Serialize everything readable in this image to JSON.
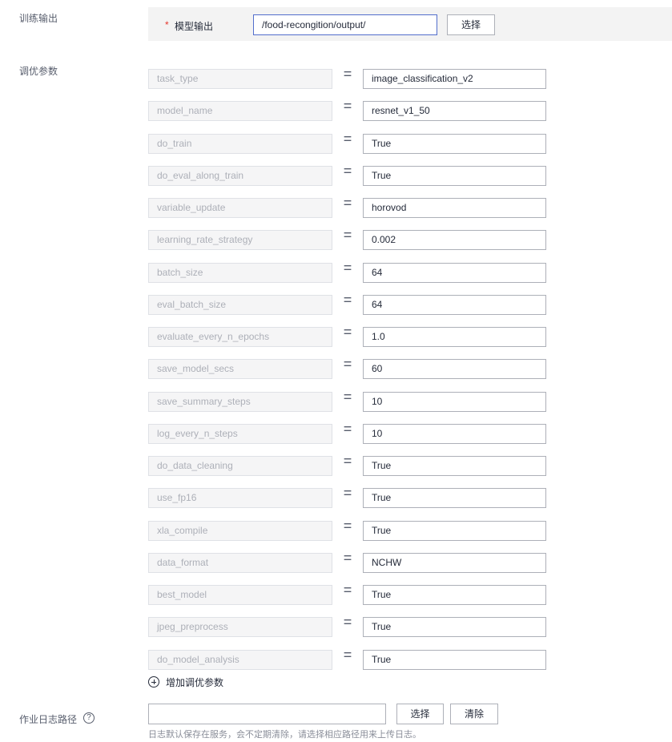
{
  "training_output": {
    "section_label": "训练输出",
    "required_mark": "*",
    "field_label": "模型输出",
    "path_value": "/food-recongition/output/",
    "select_button": "选择"
  },
  "tuning_params": {
    "section_label": "调优参数",
    "equals_sign": "=",
    "rows": [
      {
        "key": "task_type",
        "value": "image_classification_v2"
      },
      {
        "key": "model_name",
        "value": "resnet_v1_50"
      },
      {
        "key": "do_train",
        "value": "True"
      },
      {
        "key": "do_eval_along_train",
        "value": "True"
      },
      {
        "key": "variable_update",
        "value": "horovod"
      },
      {
        "key": "learning_rate_strategy",
        "value": "0.002"
      },
      {
        "key": "batch_size",
        "value": "64"
      },
      {
        "key": "eval_batch_size",
        "value": "64"
      },
      {
        "key": "evaluate_every_n_epochs",
        "value": "1.0"
      },
      {
        "key": "save_model_secs",
        "value": "60"
      },
      {
        "key": "save_summary_steps",
        "value": "10"
      },
      {
        "key": "log_every_n_steps",
        "value": "10"
      },
      {
        "key": "do_data_cleaning",
        "value": "True"
      },
      {
        "key": "use_fp16",
        "value": "True"
      },
      {
        "key": "xla_compile",
        "value": "True"
      },
      {
        "key": "data_format",
        "value": "NCHW"
      },
      {
        "key": "best_model",
        "value": "True"
      },
      {
        "key": "jpeg_preprocess",
        "value": "True"
      },
      {
        "key": "do_model_analysis",
        "value": "True"
      }
    ],
    "add_label": "增加调优参数",
    "add_icon": "plus-circle-icon"
  },
  "job_log": {
    "section_label": "作业日志路径",
    "help_icon": "question-circle-icon",
    "help_glyph": "?",
    "path_value": "",
    "select_button": "选择",
    "clear_button": "清除",
    "hint": "日志默认保存在服务，会不定期清除，请选择相应路径用来上传日志。"
  },
  "colors": {
    "required": "#e6332a",
    "focus_border": "#526ecc",
    "output_panel_bg": "#f3f3f3",
    "key_bg": "#f5f5f6"
  }
}
